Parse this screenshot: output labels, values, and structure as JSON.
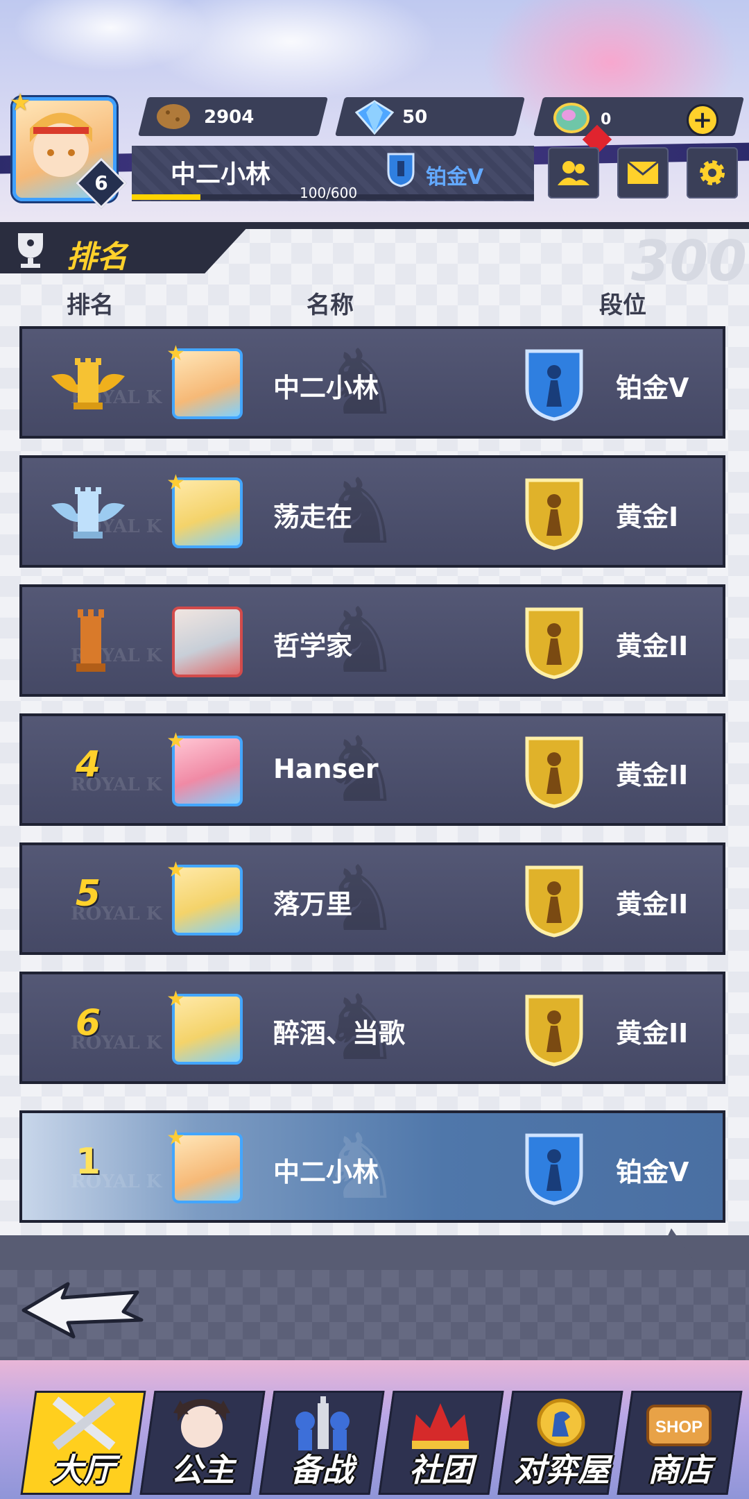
{
  "header": {
    "level": "6",
    "resources": [
      {
        "icon": "potato-coin-icon",
        "value": "2904"
      },
      {
        "icon": "diamond-icon",
        "value": "50"
      },
      {
        "icon": "rainbow-gem-icon",
        "value": "0"
      }
    ],
    "player_name": "中二小林",
    "xp": "100/600",
    "xp_fraction": 0.17,
    "rank": "铂金V",
    "buttons": [
      "friends-icon",
      "mail-icon",
      "settings-icon"
    ]
  },
  "ranking": {
    "title": "排名",
    "columns": {
      "rank": "排名",
      "name": "名称",
      "tier": "段位"
    },
    "rows": [
      {
        "rank": "",
        "rank_icon": "gold-rook-trophy-icon",
        "name": "中二小林",
        "tier": "铂金V",
        "tier_color": "platinum"
      },
      {
        "rank": "",
        "rank_icon": "silver-rook-trophy-icon",
        "name": "荡走在",
        "tier": "黄金I",
        "tier_color": "gold"
      },
      {
        "rank": "",
        "rank_icon": "bronze-rook-trophy-icon",
        "name": "哲学家",
        "tier": "黄金II",
        "tier_color": "gold"
      },
      {
        "rank": "4",
        "name": "Hanser",
        "tier": "黄金II",
        "tier_color": "gold"
      },
      {
        "rank": "5",
        "name": "落万里",
        "tier": "黄金II",
        "tier_color": "gold"
      },
      {
        "rank": "6",
        "name": "醉酒、当歌",
        "tier": "黄金II",
        "tier_color": "gold"
      }
    ],
    "self": {
      "rank": "1",
      "name": "中二小林",
      "tier": "铂金V"
    }
  },
  "nav": {
    "tabs": [
      {
        "label": "大厅",
        "icon": "swords-icon",
        "active": true
      },
      {
        "label": "公主",
        "icon": "princess-icon",
        "active": false
      },
      {
        "label": "备战",
        "icon": "chess-pieces-icon",
        "active": false
      },
      {
        "label": "社团",
        "icon": "guild-crown-icon",
        "active": false
      },
      {
        "label": "对弈屋",
        "icon": "chess-knight-coin-icon",
        "active": false
      },
      {
        "label": "商店",
        "icon": "shop-icon",
        "active": false,
        "badge": "SHOP"
      }
    ]
  },
  "colors": {
    "accent": "#ffd12b",
    "platinum": "#3f8ef0",
    "gold": "#e0b22a",
    "row": "#4b4f6e"
  }
}
